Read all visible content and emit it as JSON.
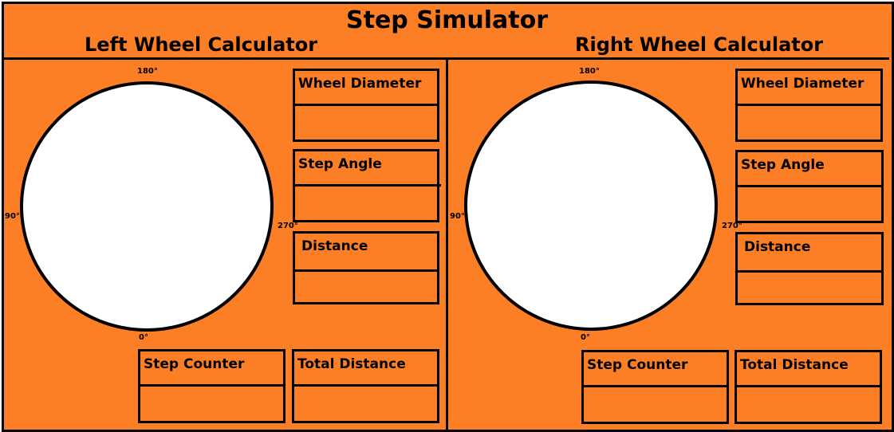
{
  "app": {
    "title": "Step Simulator",
    "accent_color": "#FC7F25"
  },
  "left_panel": {
    "title": "Left Wheel Calculator",
    "angles": {
      "top": "180°",
      "left": "90°",
      "right": "270°",
      "bottom": "0°"
    },
    "fields": {
      "wheel_diameter": {
        "label": "Wheel Diameter",
        "value": ""
      },
      "step_angle": {
        "label": "Step Angle",
        "value": ""
      },
      "distance": {
        "label": "Distance",
        "value": ""
      },
      "step_counter": {
        "label": "Step Counter",
        "value": ""
      },
      "total_distance": {
        "label": "Total Distance",
        "value": ""
      }
    }
  },
  "right_panel": {
    "title": "Right Wheel Calculator",
    "angles": {
      "top": "180°",
      "left": "90°",
      "right": "270°",
      "bottom": "0°"
    },
    "fields": {
      "wheel_diameter": {
        "label": "Wheel Diameter",
        "value": ""
      },
      "step_angle": {
        "label": "Step Angle",
        "value": ""
      },
      "distance": {
        "label": "Distance",
        "value": ""
      },
      "step_counter": {
        "label": "Step Counter",
        "value": ""
      },
      "total_distance": {
        "label": "Total Distance",
        "value": ""
      }
    }
  }
}
